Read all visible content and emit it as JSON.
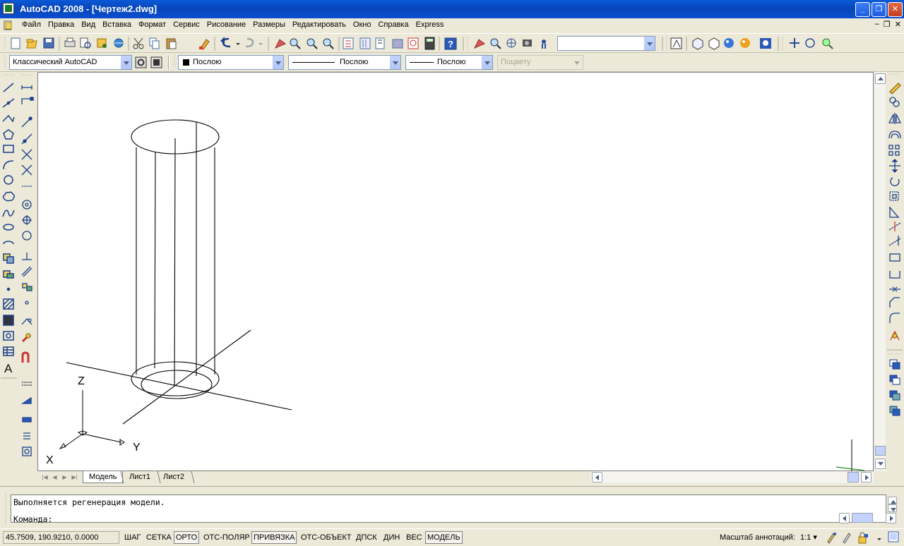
{
  "window": {
    "title": "AutoCAD 2008 - [Чертеж2.dwg]"
  },
  "menu": [
    "Файл",
    "Правка",
    "Вид",
    "Вставка",
    "Формат",
    "Сервис",
    "Рисование",
    "Размеры",
    "Редактировать",
    "Окно",
    "Справка",
    "Express"
  ],
  "toolbar2": {
    "workspace": "Классический AutoCAD",
    "color": "Послою",
    "linetype": "Послою",
    "lineweight": "Послою",
    "plotstyle": "Поцвету"
  },
  "toolbar1": {
    "named_view": ""
  },
  "layout_tabs": [
    "Модель",
    "Лист1",
    "Лист2"
  ],
  "ucs_labels": {
    "x": "X",
    "y": "Y",
    "z": "Z"
  },
  "command": {
    "history": "Выполняется регенерация модели.",
    "prompt": "Команда:"
  },
  "status": {
    "coords": "45.7509, 190.9210, 0.0000",
    "toggles": [
      {
        "label": "ШАГ",
        "on": false
      },
      {
        "label": "СЕТКА",
        "on": false
      },
      {
        "label": "ОРТО",
        "on": true
      },
      {
        "label": "ОТС-ПОЛЯР",
        "on": false
      },
      {
        "label": "ПРИВЯЗКА",
        "on": true
      },
      {
        "label": "ОТС-ОБЪЕКТ",
        "on": false
      },
      {
        "label": "ДПСК",
        "on": false
      },
      {
        "label": "ДИН",
        "on": false
      },
      {
        "label": "ВЕС",
        "on": false
      },
      {
        "label": "МОДЕЛЬ",
        "on": true
      }
    ],
    "annotation_scale_label": "Масштаб аннотаций:",
    "annotation_scale_value": "1:1"
  }
}
